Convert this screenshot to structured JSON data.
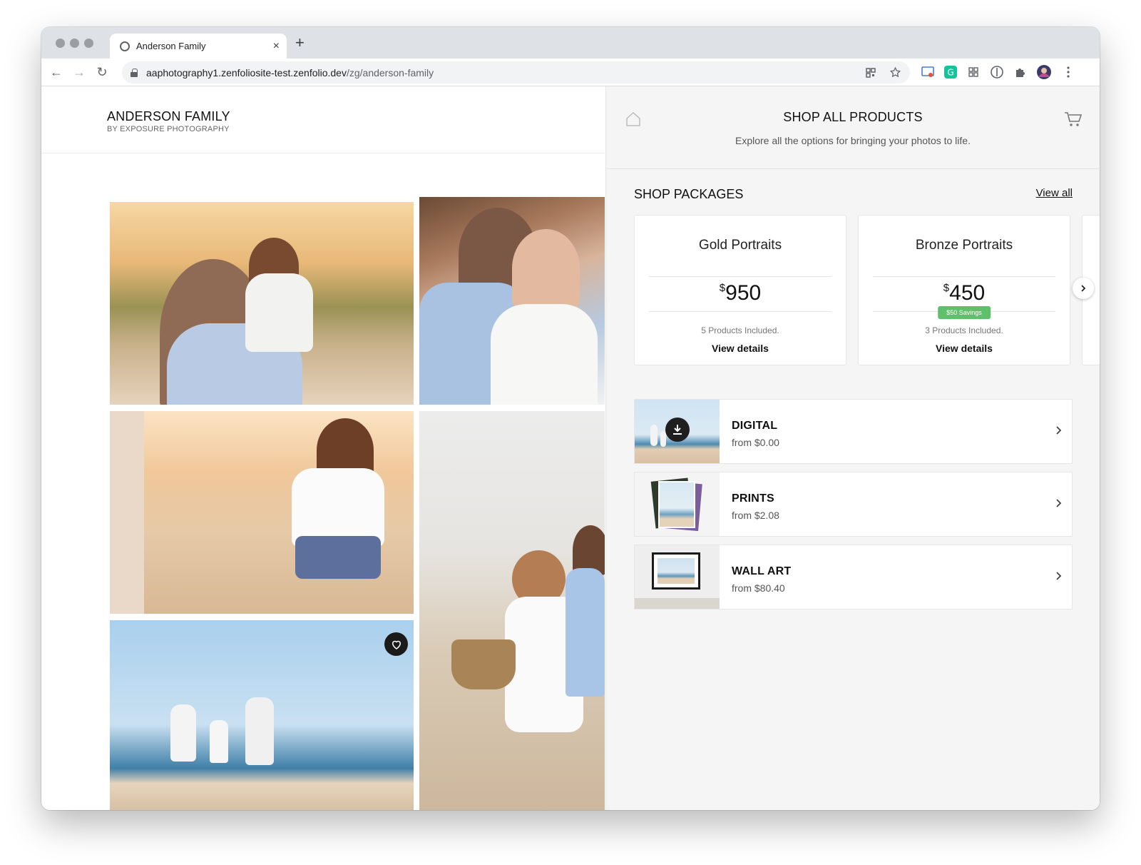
{
  "browser": {
    "tab_title": "Anderson Family",
    "tab_close": "×",
    "new_tab": "+",
    "url_host": "aaphotography1.zenfoliosite-test.zenfolio.dev",
    "url_path": "/zg/anderson-family",
    "nav": {
      "back": "←",
      "forward": "→",
      "reload": "↻"
    }
  },
  "site": {
    "title": "ANDERSON FAMILY",
    "subtitle": "BY EXPOSURE PHOTOGRAPHY"
  },
  "panel": {
    "title": "SHOP ALL PRODUCTS",
    "subtitle": "Explore all the options for bringing your photos to life.",
    "packages_heading": "SHOP PACKAGES",
    "view_all": "View all",
    "packages": [
      {
        "name": "Gold Portraits",
        "currency": "$",
        "price": "950",
        "savings": "",
        "included": "5 Products Included.",
        "view": "View details"
      },
      {
        "name": "Bronze Portraits",
        "currency": "$",
        "price": "450",
        "savings": "$50 Savings",
        "included": "3 Products Included.",
        "view": "View details"
      }
    ],
    "products": [
      {
        "name": "DIGITAL",
        "price": "from $0.00"
      },
      {
        "name": "PRINTS",
        "price": "from $2.08"
      },
      {
        "name": "WALL ART",
        "price": "from $80.40"
      }
    ]
  },
  "colors": {
    "savings_badge": "#5fbf6a",
    "panel_bg": "#f5f5f5",
    "heart_button": "#1a1a1a"
  }
}
